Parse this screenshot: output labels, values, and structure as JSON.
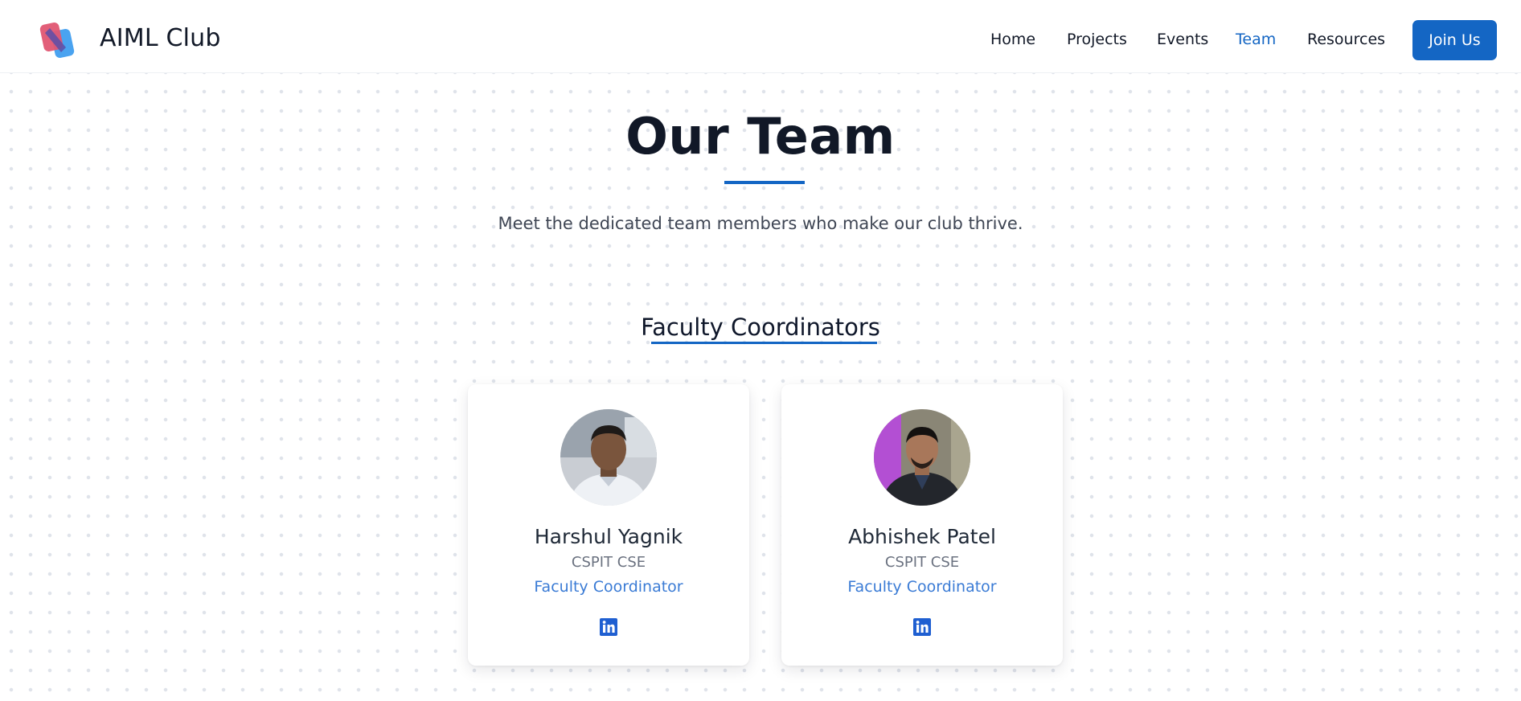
{
  "header": {
    "brand": "AIML Club",
    "nav": [
      {
        "label": "Home",
        "active": false
      },
      {
        "label": "Projects",
        "active": false
      },
      {
        "label": "Events",
        "active": false
      },
      {
        "label": "Team",
        "active": true
      },
      {
        "label": "Resources",
        "active": false
      }
    ],
    "join_label": "Join Us",
    "logo_icon": "aiml-club-logo-icon"
  },
  "hero": {
    "title": "Our Team",
    "subtitle": "Meet the dedicated team members who make our club thrive."
  },
  "section": {
    "title": "Faculty Coordinators",
    "members": [
      {
        "name": "Harshul Yagnik",
        "dept": "CSPIT CSE",
        "role": "Faculty Coordinator",
        "icon": "linkedin-icon"
      },
      {
        "name": "Abhishek Patel",
        "dept": "CSPIT CSE",
        "role": "Faculty Coordinator",
        "icon": "linkedin-icon"
      }
    ]
  },
  "colors": {
    "accent": "#1466c4",
    "role_text": "#3a7bd5",
    "logo_red": "#e05672",
    "logo_blue": "#4aa3f0"
  }
}
